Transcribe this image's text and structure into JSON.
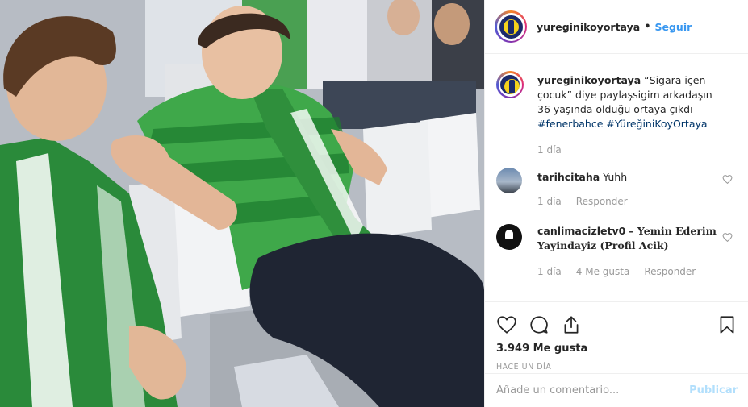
{
  "post": {
    "username": "yureginikoyortaya",
    "follow_label": "Seguir",
    "caption": {
      "username": "yureginikoyortaya",
      "text": "“Sigara içen çocuk” diye paylaşsigim arkadaşın 36 yaşında olduğu ortaya çıkdı",
      "hashtags": "#fenerbahce #YüreğiniKoyOrtaya",
      "time": "1 día"
    },
    "comments": [
      {
        "username": "tarihcitaha",
        "text": "Yuhh",
        "time": "1 día",
        "likes": "",
        "reply_label": "Responder"
      },
      {
        "username": "canlimacizletv0",
        "text": "– Yemin Ederim Yayindayiz (Profil Acik)",
        "time": "1 día",
        "likes": "4 Me gusta",
        "reply_label": "Responder"
      }
    ],
    "likes_count": "3.949 Me gusta",
    "date_label": "HACE UN DÍA",
    "add_comment_placeholder": "Añade un comentario...",
    "publish_label": "Publicar",
    "icons": [
      "heart-icon",
      "comment-icon",
      "share-icon",
      "bookmark-icon"
    ],
    "colors": {
      "link": "#3897f0",
      "publish_disabled": "#b2dffc",
      "hashtag": "#003569",
      "muted": "#999999"
    }
  }
}
